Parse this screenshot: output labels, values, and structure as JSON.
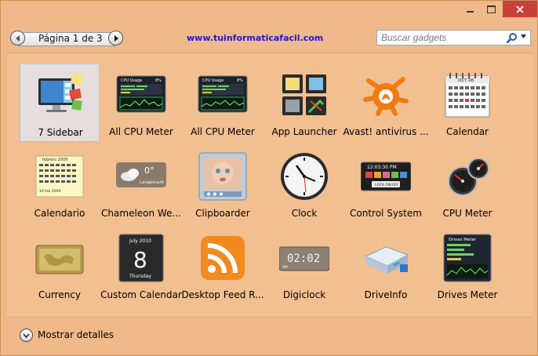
{
  "window": {
    "close_glyph": "x"
  },
  "pager": {
    "label": "Página 1 de 3"
  },
  "toolbar": {
    "site": "www.tuinformaticafacil.com"
  },
  "search": {
    "placeholder": "Buscar gadgets"
  },
  "gadgets": [
    {
      "label": "7 Sidebar",
      "icon": "monitor-sidebar-icon",
      "selected": true
    },
    {
      "label": "All CPU Meter",
      "icon": "cpu-usage-panel-icon",
      "panel_title": "CPU Usage",
      "panel_pct": "8%"
    },
    {
      "label": "All CPU Meter",
      "icon": "cpu-usage-panel-icon",
      "panel_title": "CPU Usage",
      "panel_pct": "8%"
    },
    {
      "label": "App Launcher",
      "icon": "app-launcher-icon"
    },
    {
      "label": "Avast! antivirus ...",
      "icon": "avast-icon"
    },
    {
      "label": "Calendar",
      "icon": "calendar-icon",
      "month": "OCT 06"
    },
    {
      "label": "Calendario",
      "icon": "calendario-icon",
      "month": "febrero 2009",
      "footer": "19 feb 2009"
    },
    {
      "label": "Chameleon We...",
      "icon": "weather-icon",
      "temp": "0°",
      "place": "Langemark"
    },
    {
      "label": "Clipboarder",
      "icon": "clipboarder-icon"
    },
    {
      "label": "Clock",
      "icon": "clock-icon"
    },
    {
      "label": "Control System",
      "icon": "control-system-icon",
      "time": "12:03:30 PM",
      "lock": "LOCK ON/OFF"
    },
    {
      "label": "CPU Meter",
      "icon": "cpu-meter-gauge-icon"
    },
    {
      "label": "Currency",
      "icon": "currency-card-icon"
    },
    {
      "label": "Custom Calendar",
      "icon": "custom-calendar-icon",
      "month": "July 2010",
      "day": "8",
      "weekday": "Thursday"
    },
    {
      "label": "Desktop Feed R...",
      "icon": "rss-feed-icon"
    },
    {
      "label": "Digiclock",
      "icon": "digiclock-icon",
      "time": "02:02",
      "ampm": "AM"
    },
    {
      "label": "DriveInfo",
      "icon": "drive-info-icon"
    },
    {
      "label": "Drives Meter",
      "icon": "drives-meter-icon",
      "panel_title": "Drives Meter"
    }
  ],
  "footer": {
    "details_label": "Mostrar detalles"
  }
}
